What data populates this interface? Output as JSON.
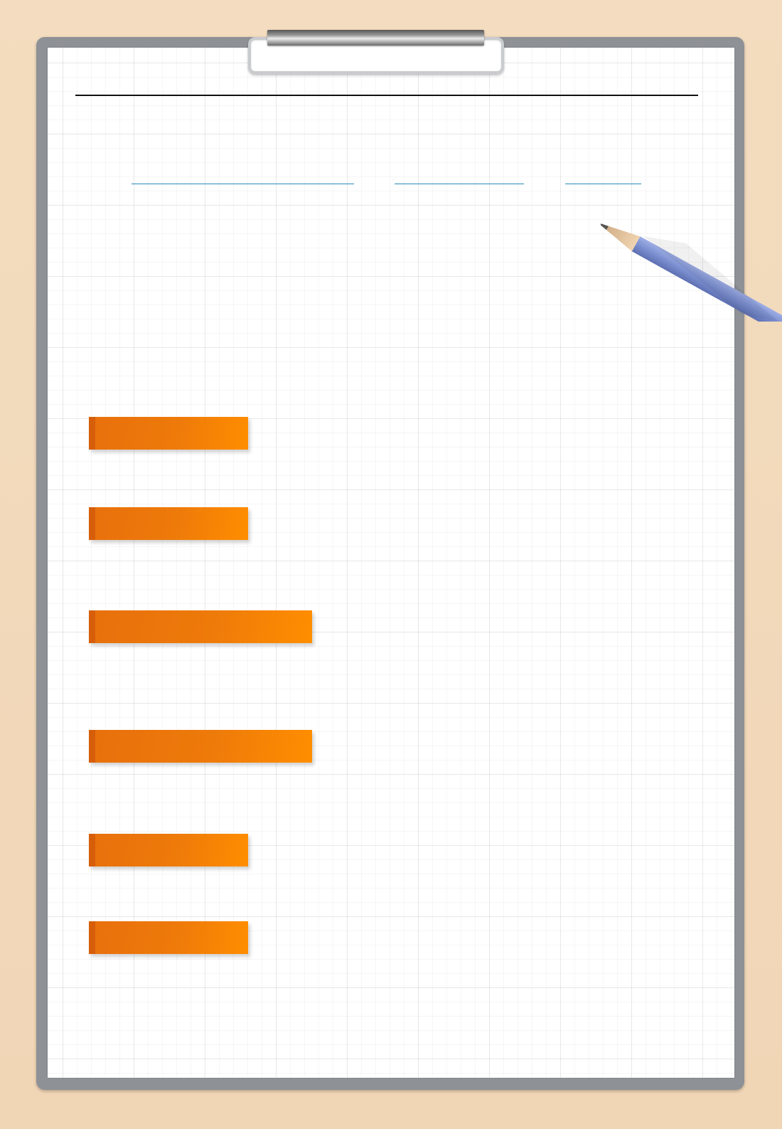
{
  "document": {
    "title": "",
    "fill_in_blanks": [
      {
        "name": "blank-1",
        "value": ""
      },
      {
        "name": "blank-2",
        "value": ""
      },
      {
        "name": "blank-3",
        "value": ""
      }
    ],
    "section_tags": [
      {
        "label": ""
      },
      {
        "label": ""
      },
      {
        "label": ""
      },
      {
        "label": ""
      },
      {
        "label": ""
      },
      {
        "label": ""
      }
    ]
  },
  "colors": {
    "board": "#f3dcbf",
    "frame": "#8e9196",
    "tag_orange": "#ee7a0a",
    "blank_line": "#2a8ab9",
    "pencil": "#7b8fd0"
  }
}
